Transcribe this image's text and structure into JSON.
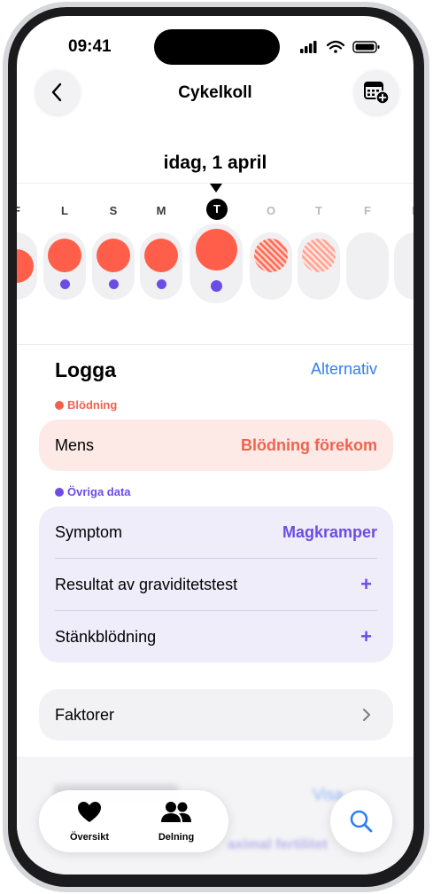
{
  "status": {
    "time": "09:41"
  },
  "nav": {
    "title": "Cykelkoll",
    "back_icon": "chevron-left-icon",
    "calendar_icon": "calendar-add-icon"
  },
  "date": {
    "title": "idag, 1 april"
  },
  "week": {
    "days": [
      {
        "letter": "F",
        "state": "past-partial"
      },
      {
        "letter": "L",
        "state": "period"
      },
      {
        "letter": "S",
        "state": "period"
      },
      {
        "letter": "M",
        "state": "period"
      },
      {
        "letter": "T",
        "state": "today-period"
      },
      {
        "letter": "O",
        "state": "predicted"
      },
      {
        "letter": "T",
        "state": "predicted-light"
      },
      {
        "letter": "F",
        "state": "empty"
      },
      {
        "letter": "L",
        "state": "empty-partial"
      }
    ],
    "period_color": "#ff5f4a",
    "symptom_color": "#6b4ce6"
  },
  "log": {
    "title": "Logga",
    "options_link": "Alternativ",
    "bleeding": {
      "category": "Blödning",
      "color": "#f0624d",
      "row_label": "Mens",
      "row_value": "Blödning förekom"
    },
    "other": {
      "category": "Övriga data",
      "color": "#6b4ce6",
      "rows": [
        {
          "label": "Symptom",
          "value": "Magkramper"
        },
        {
          "label": "Resultat av graviditetstest",
          "value": "+"
        },
        {
          "label": "Stänkblödning",
          "value": "+"
        }
      ]
    },
    "factors": {
      "label": "Faktorer"
    }
  },
  "below": {
    "show_link": "Visa",
    "fertility_text": "aximal fertilitet"
  },
  "tabbar": {
    "tabs": [
      {
        "label": "Översikt",
        "icon": "heart-icon"
      },
      {
        "label": "Delning",
        "icon": "people-icon"
      }
    ],
    "search_icon": "search-icon"
  }
}
